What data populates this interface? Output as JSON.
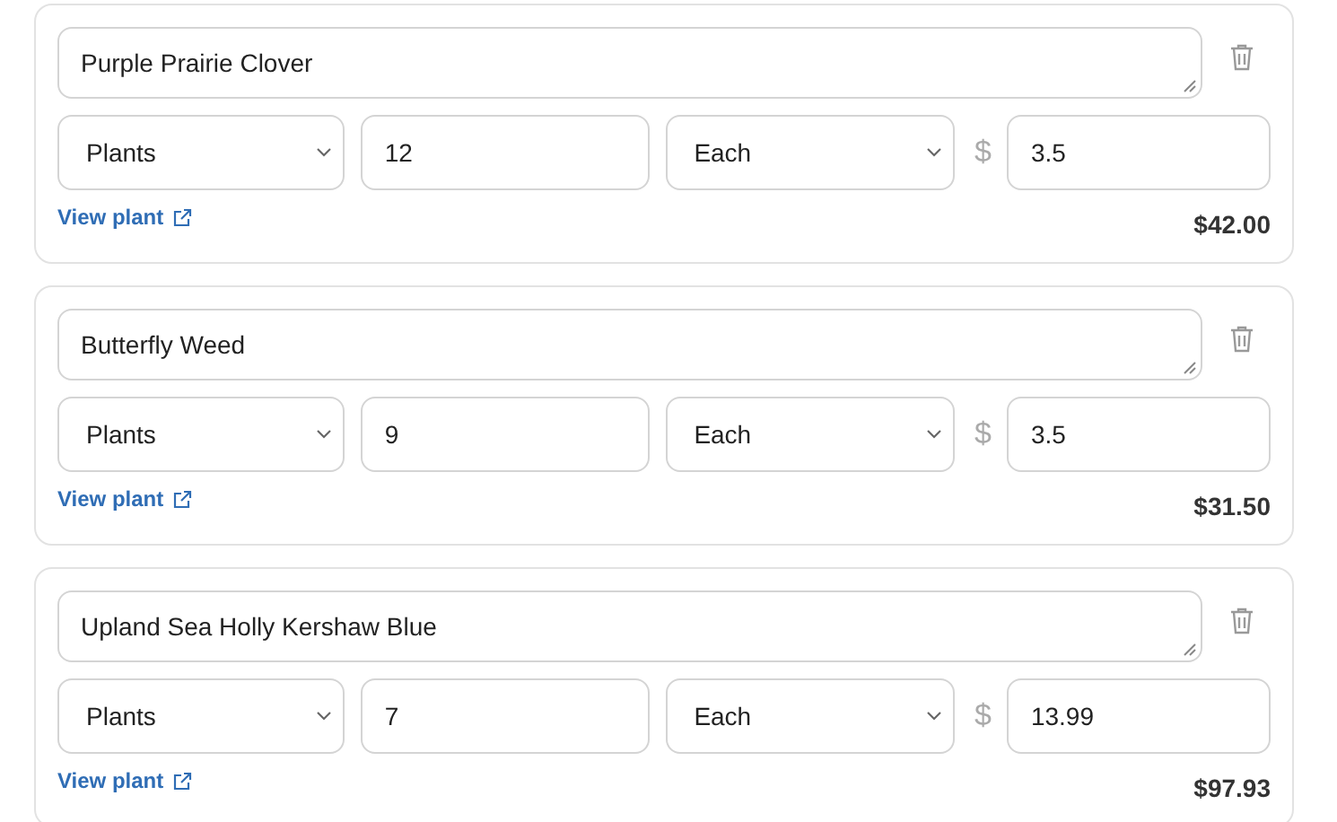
{
  "items": [
    {
      "name": "Purple Prairie Clover",
      "category": "Plants",
      "quantity": "12",
      "unit": "Each",
      "currency": "$",
      "price": "3.5",
      "link": "View plant",
      "total": "$42.00"
    },
    {
      "name": "Butterfly Weed",
      "category": "Plants",
      "quantity": "9",
      "unit": "Each",
      "currency": "$",
      "price": "3.5",
      "link": "View plant",
      "total": "$31.50"
    },
    {
      "name": "Upland Sea Holly Kershaw Blue",
      "category": "Plants",
      "quantity": "7",
      "unit": "Each",
      "currency": "$",
      "price": "13.99",
      "link": "View plant",
      "total": "$97.93"
    }
  ]
}
